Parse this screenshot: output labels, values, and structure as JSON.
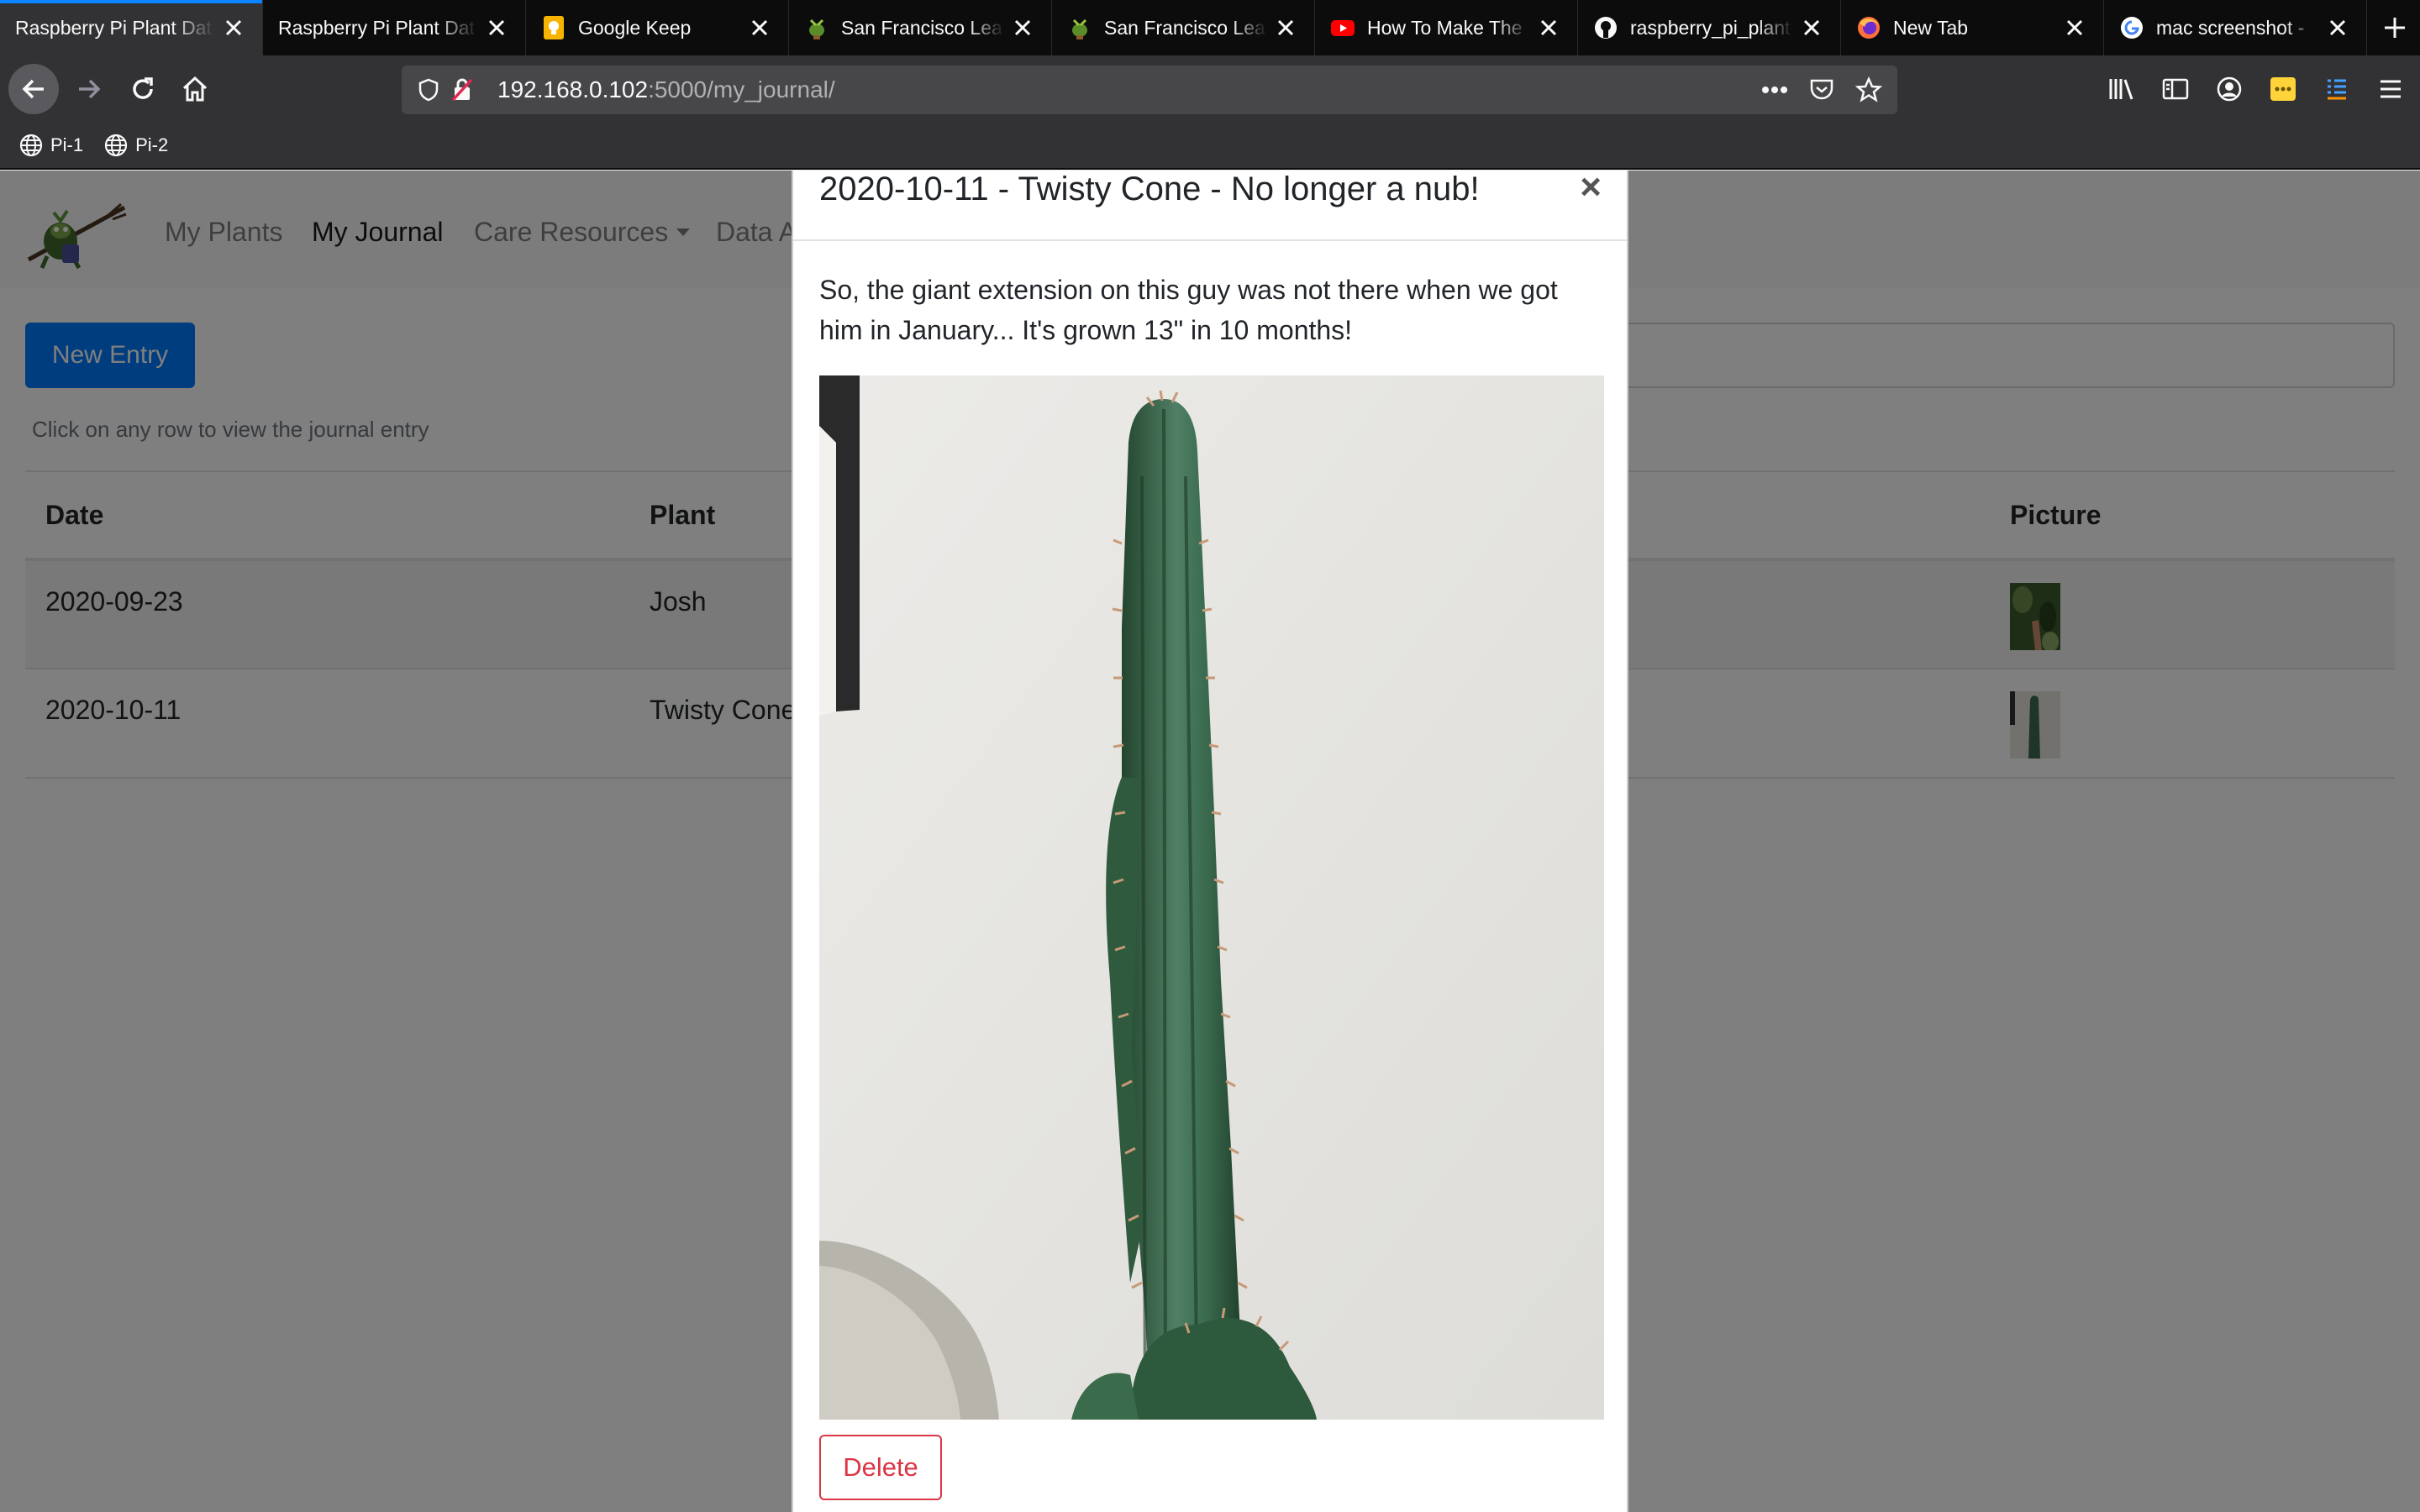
{
  "browser": {
    "tabs": [
      {
        "title": "Raspberry Pi Plant Dat",
        "icon": "none",
        "active": true
      },
      {
        "title": "Raspberry Pi Plant Dat",
        "icon": "none",
        "active": false
      },
      {
        "title": "Google Keep",
        "icon": "google-keep-icon",
        "active": false
      },
      {
        "title": "San Francisco Lea",
        "icon": "plant-icon",
        "active": false
      },
      {
        "title": "San Francisco Lea",
        "icon": "plant-icon",
        "active": false
      },
      {
        "title": "How To Make The",
        "icon": "youtube-icon",
        "active": false
      },
      {
        "title": "raspberry_pi_plant",
        "icon": "github-icon",
        "active": false
      },
      {
        "title": "New Tab",
        "icon": "firefox-icon",
        "active": false
      },
      {
        "title": "mac screenshot -",
        "icon": "google-icon",
        "active": false
      }
    ],
    "url_host": "192.168.0.102",
    "url_rest": ":5000/my_journal/",
    "bookmarks": [
      "Pi-1",
      "Pi-2"
    ]
  },
  "site": {
    "nav": {
      "my_plants": "My Plants",
      "my_journal": "My Journal",
      "care_resources": "Care Resources",
      "data": "Data A"
    },
    "new_entry": "New Entry",
    "hint": "Click on any row to view the journal entry",
    "table": {
      "headers": {
        "date": "Date",
        "plant": "Plant",
        "picture": "Picture"
      },
      "rows": [
        {
          "date": "2020-09-23",
          "plant": "Josh"
        },
        {
          "date": "2020-10-11",
          "plant": "Twisty Cone"
        }
      ]
    }
  },
  "modal": {
    "title": "2020-10-11 - Twisty Cone - No longer a nub!",
    "close": "×",
    "body": "So, the giant extension on this guy was not there when we got him in January... It's grown 13\" in 10 months!",
    "delete": "Delete"
  },
  "colors": {
    "primary": "#007bff",
    "danger": "#dc3545",
    "tab_accent": "#0a84ff"
  }
}
